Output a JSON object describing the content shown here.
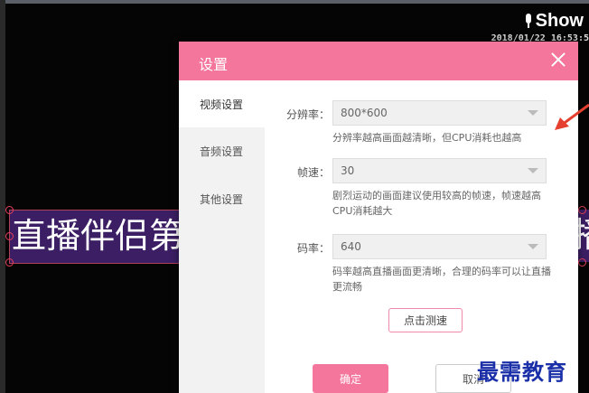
{
  "app": {
    "show_label": "Show",
    "timestamp": "2018/01/22 16:53:5"
  },
  "overlay": {
    "text_left": "直播伴侣第",
    "text_right": "播"
  },
  "dialog": {
    "title": "设置",
    "sidebar": [
      {
        "label": "视频设置",
        "active": true
      },
      {
        "label": "音频设置",
        "active": false
      },
      {
        "label": "其他设置",
        "active": false
      }
    ],
    "resolution": {
      "label": "分辨率：",
      "value": "800*600",
      "hint": "分辨率越高画面越清晰，但CPU消耗也越高"
    },
    "framerate": {
      "label": "帧速：",
      "value": "30",
      "hint": "剧烈运动的画面建议使用较高的帧速，帧速越高CPU消耗越大"
    },
    "bitrate": {
      "label": "码率：",
      "value": "640",
      "hint": "码率越高直播画面更清晰，合理的码率可以让直播更流畅"
    },
    "speed_test_label": "点击测速",
    "ok_label": "确定",
    "cancel_label": "取消"
  },
  "watermark": "最需教育",
  "colors": {
    "accent": "#f4769c",
    "annotation_arrow": "#e5402f",
    "watermark": "#1a2fa8"
  }
}
